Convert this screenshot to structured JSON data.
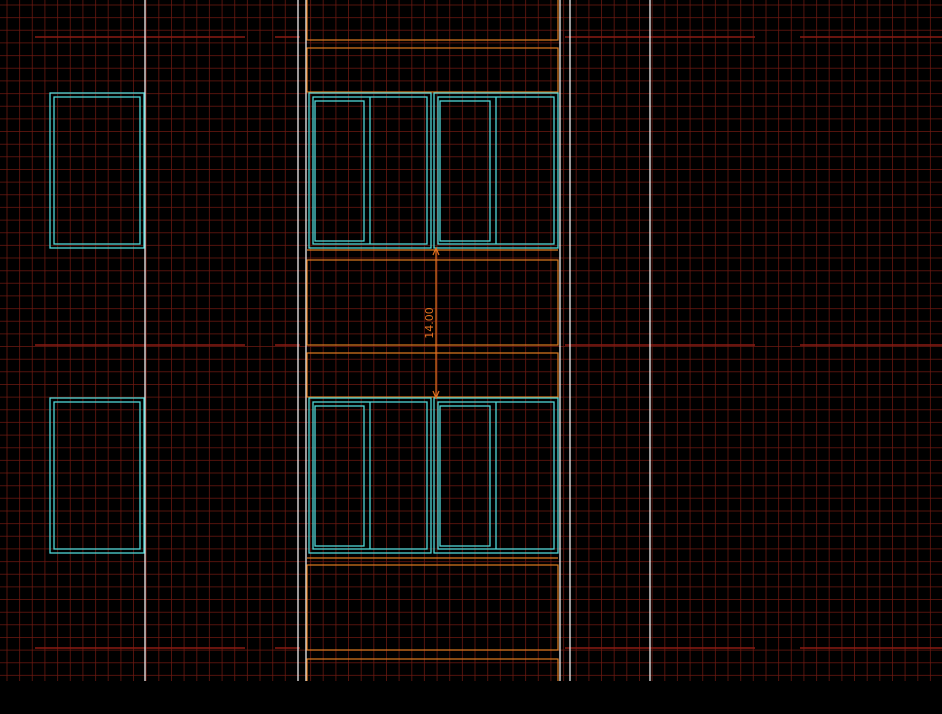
{
  "colors": {
    "background": "#000000",
    "grid": "#6e1a12",
    "axis_line": "#ffffff",
    "window_frame": "#4fd6d6",
    "slab_outline": "#e07b1f",
    "level_line": "#8a1a12",
    "dimension": "#e0701f"
  },
  "dimension": {
    "text": "14.00"
  }
}
